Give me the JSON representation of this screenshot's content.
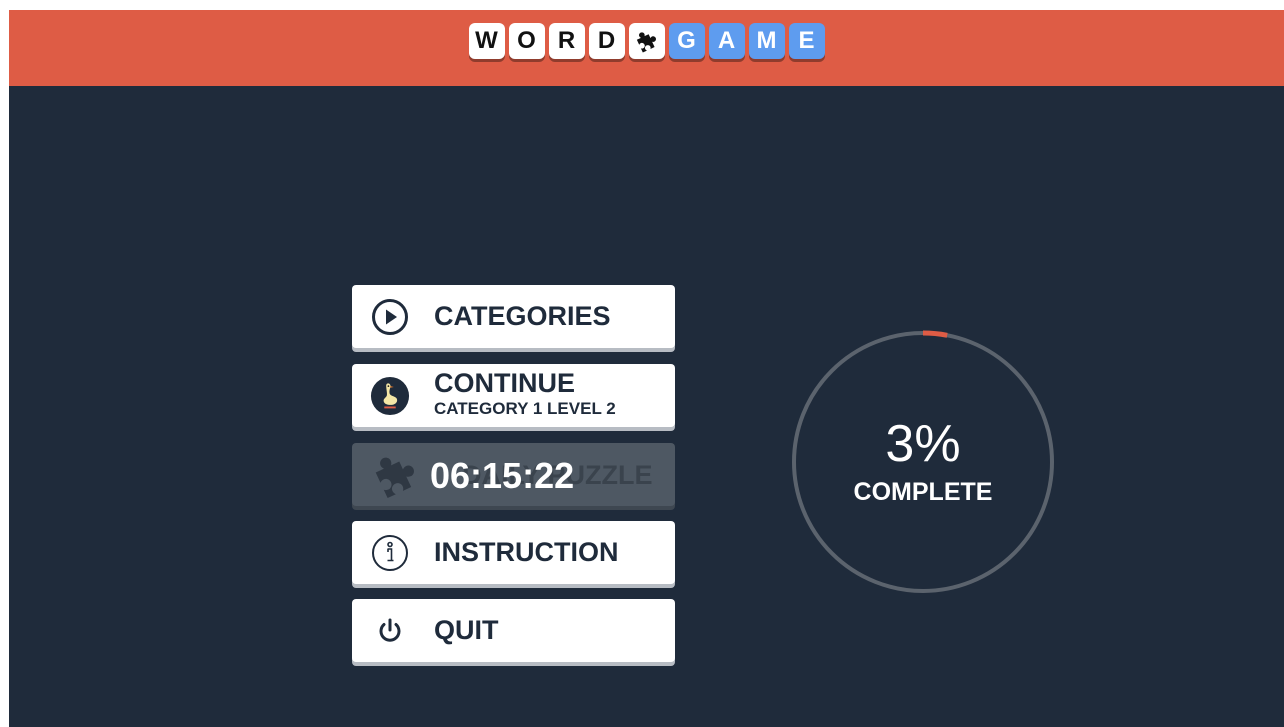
{
  "header": {
    "title_tiles_word": [
      "W",
      "O",
      "R",
      "D"
    ],
    "title_puzzle_icon": "puzzle-piece-icon",
    "title_tiles_game": [
      "G",
      "A",
      "M",
      "E"
    ],
    "colors": {
      "header_bg": "#de5c45",
      "tile_blue": "#5e9cef",
      "tile_white": "#ffffff"
    }
  },
  "menu": {
    "categories": {
      "label": "CATEGORIES",
      "icon": "play-circle-icon"
    },
    "continue": {
      "label": "CONTINUE",
      "sublabel": "CATEGORY 1 LEVEL 2",
      "icon": "duck-avatar-icon"
    },
    "daily_puzzle": {
      "label": "DAILY PUZZLE",
      "timer": "06:15:22",
      "icon": "puzzle-piece-icon",
      "state": "locked"
    },
    "instruction": {
      "label": "INSTRUCTION",
      "icon": "info-circle-icon"
    },
    "quit": {
      "label": "QUIT",
      "icon": "power-icon"
    }
  },
  "progress": {
    "percent_text": "3%",
    "caption": "COMPLETE",
    "fraction": 0.03,
    "colors": {
      "track": "#5b636d",
      "fill": "#de5c45"
    }
  },
  "background_color": "#1f2b3b"
}
